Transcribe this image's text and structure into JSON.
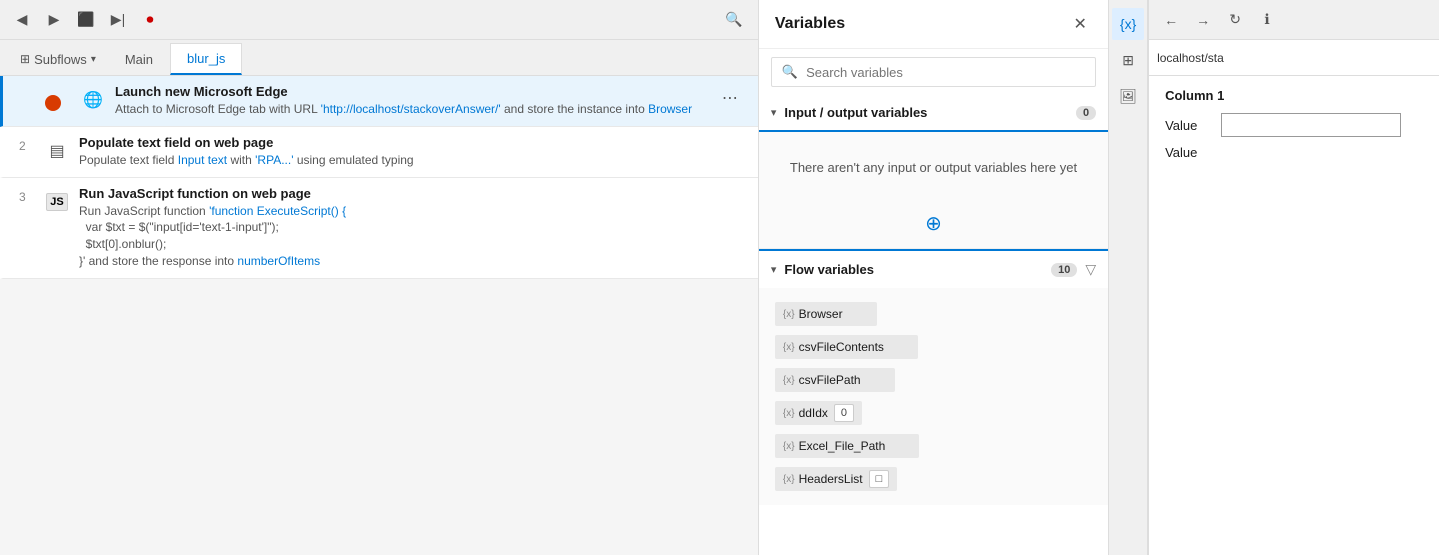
{
  "toolbar": {
    "buttons": [
      "▶",
      "▶▶",
      "⬜",
      "▶|",
      "⏺"
    ],
    "search_icon": "🔍"
  },
  "tabs": {
    "subflows_label": "Subflows",
    "main_label": "Main",
    "blur_label": "blur_js",
    "active": "blur_js"
  },
  "steps": [
    {
      "number": "",
      "icon_type": "dot",
      "title": "Launch new Microsoft Edge",
      "desc_parts": [
        {
          "text": "Attach to Microsoft Edge tab with URL "
        },
        {
          "text": "'http://localhost/stackoverAnswer/'",
          "link": true
        },
        {
          "text": " and store the instance into"
        }
      ],
      "variable": "Browser",
      "highlighted": true,
      "has_more": true
    },
    {
      "number": "2",
      "icon_type": "textfield",
      "title": "Populate text field on web page",
      "desc_parts": [
        {
          "text": "Populate text field "
        },
        {
          "text": "Input text",
          "link": true
        },
        {
          "text": " with "
        },
        {
          "text": "'RPA...'",
          "link": true
        },
        {
          "text": " using emulated typing"
        }
      ],
      "highlighted": false,
      "has_more": false
    },
    {
      "number": "3",
      "icon_type": "js",
      "title": "Run JavaScript function on web page",
      "desc_parts": [
        {
          "text": "Run JavaScript function "
        },
        {
          "text": "'function ExecuteScript() {",
          "link": true
        },
        {
          "text": "  var $txt = $(\"input[id='text-1-input']\");"
        },
        {
          "text": "  $txt[0].onblur();"
        },
        {
          "text": "}'"
        },
        {
          "text": " and store the response into "
        },
        {
          "text": "numberOfItems",
          "link": true
        }
      ],
      "highlighted": false,
      "has_more": false
    }
  ],
  "variables_panel": {
    "title": "Variables",
    "close_btn": "✕",
    "search_placeholder": "Search variables",
    "input_output": {
      "title": "Input / output variables",
      "badge": "0",
      "expanded": true,
      "empty_text": "There aren't any input or output variables here yet",
      "add_icon": "+"
    },
    "flow": {
      "title": "Flow variables",
      "badge": "10",
      "expanded": true,
      "filter_icon": "▽",
      "vars": [
        {
          "name": "Browser",
          "value": null
        },
        {
          "name": "csvFileContents",
          "value": null
        },
        {
          "name": "csvFilePath",
          "value": null
        },
        {
          "name": "ddIdx",
          "value": "0"
        },
        {
          "name": "Excel_File_Path",
          "value": null
        },
        {
          "name": "HeadersList",
          "value": "□"
        }
      ]
    }
  },
  "icon_sidebar": {
    "buttons": [
      {
        "icon": "{x}",
        "active": true,
        "name": "variables-sidebar-btn"
      },
      {
        "icon": "⊞",
        "active": false,
        "name": "layers-sidebar-btn"
      },
      {
        "icon": "🖼",
        "active": false,
        "name": "image-sidebar-btn"
      }
    ]
  },
  "right_panel": {
    "toolbar_buttons": [
      "←",
      "→",
      "↻",
      "ℹ"
    ],
    "url": "localhost/sta",
    "column_header": "Column 1",
    "rows": [
      {
        "label": "Value",
        "has_input": true
      },
      {
        "label": "Value",
        "has_input": false
      }
    ]
  }
}
